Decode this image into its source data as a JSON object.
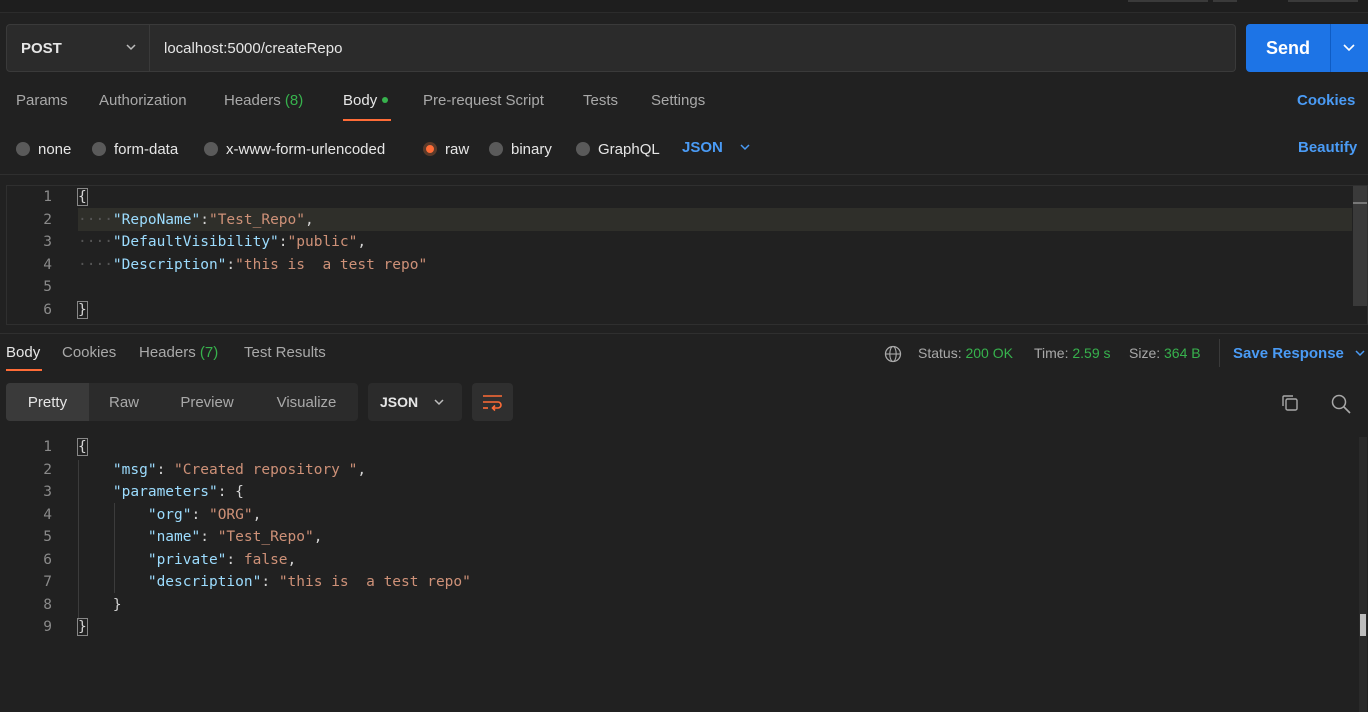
{
  "request": {
    "method": "POST",
    "url": "localhost:5000/createRepo",
    "send_label": "Send"
  },
  "request_tabs": {
    "params": "Params",
    "authorization": "Authorization",
    "headers": "Headers",
    "headers_count": "(8)",
    "body": "Body",
    "pre_request": "Pre-request Script",
    "tests": "Tests",
    "settings": "Settings",
    "cookies": "Cookies"
  },
  "body_types": {
    "none": "none",
    "form_data": "form-data",
    "urlencoded": "x-www-form-urlencoded",
    "raw": "raw",
    "binary": "binary",
    "graphql": "GraphQL",
    "selected": "raw",
    "language": "JSON",
    "beautify": "Beautify"
  },
  "request_body": {
    "line_numbers": [
      "1",
      "2",
      "3",
      "4",
      "5",
      "6"
    ],
    "lines": {
      "l1": "{",
      "l2_key": "\"RepoName\"",
      "l2_val": "\"Test_Repo\"",
      "l3_key": "\"DefaultVisibility\"",
      "l3_val": "\"public\"",
      "l4_key": "\"Description\"",
      "l4_val": "\"this is  a test repo\"",
      "l6": "}"
    }
  },
  "response_tabs": {
    "body": "Body",
    "cookies": "Cookies",
    "headers": "Headers",
    "headers_count": "(7)",
    "test_results": "Test Results"
  },
  "response_meta": {
    "status_label": "Status:",
    "status_value": "200 OK",
    "time_label": "Time:",
    "time_value": "2.59 s",
    "size_label": "Size:",
    "size_value": "364 B",
    "save_response": "Save Response",
    "status_color": "#37b24d"
  },
  "view_modes": {
    "pretty": "Pretty",
    "raw": "Raw",
    "preview": "Preview",
    "visualize": "Visualize",
    "format": "JSON"
  },
  "response_body": {
    "line_numbers": [
      "1",
      "2",
      "3",
      "4",
      "5",
      "6",
      "7",
      "8",
      "9"
    ],
    "lines": {
      "l1": "{",
      "msg_key": "\"msg\"",
      "msg_val": "\"Created repository \"",
      "params_key": "\"parameters\"",
      "org_key": "\"org\"",
      "org_val": "\"ORG\"",
      "name_key": "\"name\"",
      "name_val": "\"Test_Repo\"",
      "private_key": "\"private\"",
      "private_val": "false",
      "desc_key": "\"description\"",
      "desc_val": "\"this is  a test repo\"",
      "l8": "}",
      "l9": "}"
    }
  },
  "colors": {
    "accent_orange": "#ff6c37",
    "link_blue": "#4a9bf5",
    "send_blue": "#1d74e6",
    "background": "#212121"
  }
}
